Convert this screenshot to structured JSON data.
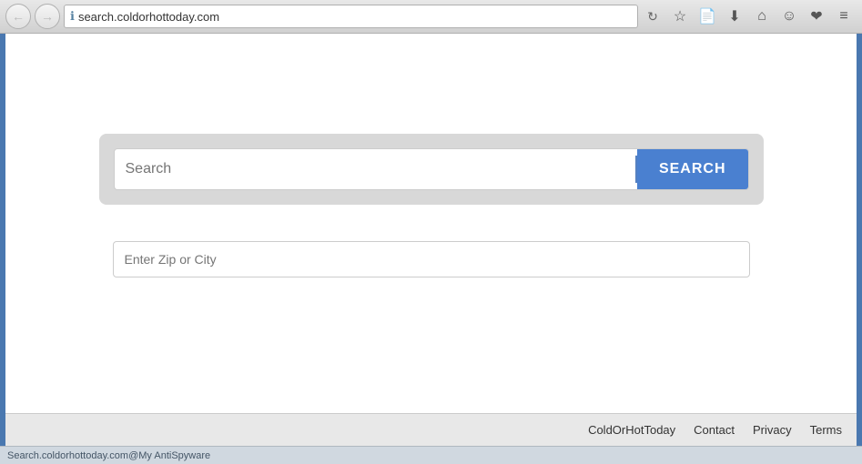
{
  "browser": {
    "url": "search.coldorhottoday.com",
    "back_btn_label": "←",
    "forward_btn_label": "→",
    "refresh_label": "↻",
    "info_icon": "ℹ",
    "home_icon": "⌂",
    "bookmark_icon": "☆",
    "history_icon": "☰",
    "download_icon": "⬇",
    "face_icon": "☺",
    "pocket_icon": "❤",
    "menu_icon": "≡",
    "reading_icon": "📄"
  },
  "search": {
    "placeholder": "Search",
    "button_label": "SEARCH"
  },
  "zip": {
    "placeholder": "Enter Zip or City"
  },
  "footer": {
    "brand": "ColdOrHotToday",
    "contact": "Contact",
    "privacy": "Privacy",
    "terms": "Terms"
  },
  "status": {
    "text": "Search.coldorhottoday.com@My AntiSpyware"
  }
}
